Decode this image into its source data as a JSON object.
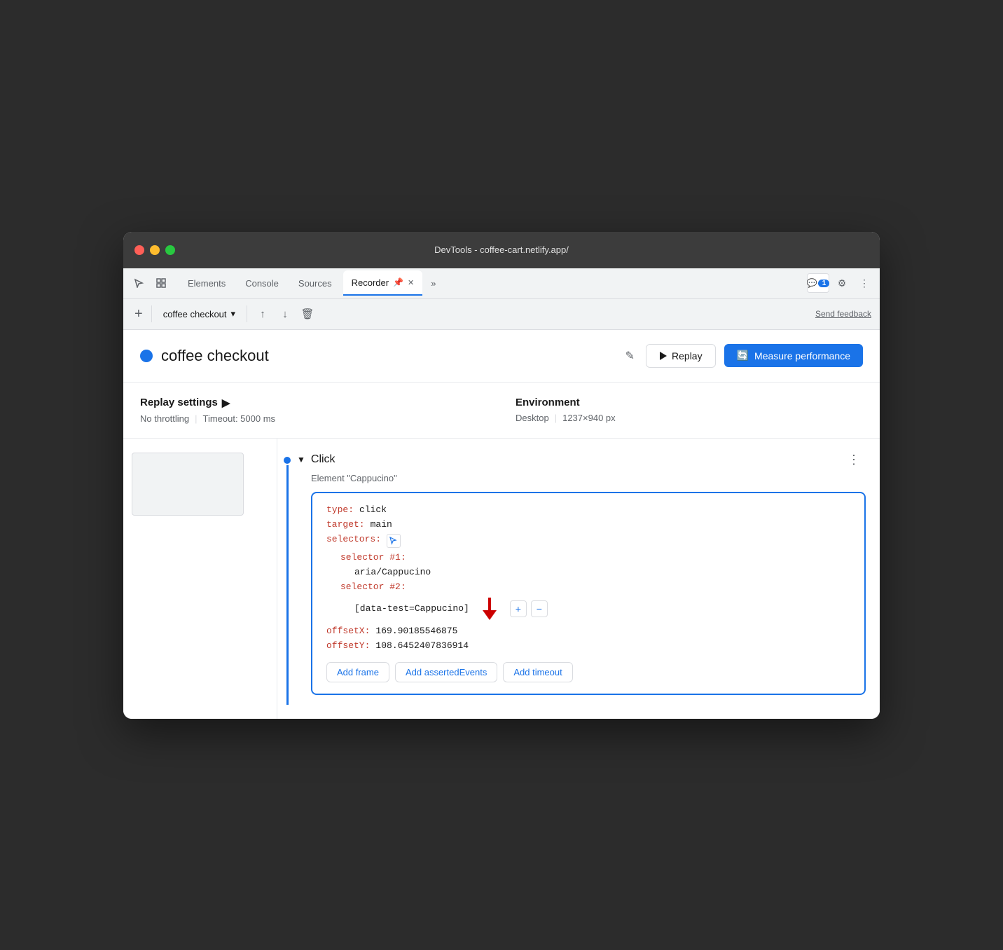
{
  "titlebar": {
    "title": "DevTools - coffee-cart.netlify.app/"
  },
  "tabs": [
    {
      "id": "elements",
      "label": "Elements",
      "active": false
    },
    {
      "id": "console",
      "label": "Console",
      "active": false
    },
    {
      "id": "sources",
      "label": "Sources",
      "active": false
    },
    {
      "id": "recorder",
      "label": "Recorder",
      "active": true
    },
    {
      "id": "more",
      "label": "»",
      "active": false
    }
  ],
  "notification": {
    "icon": "💬",
    "count": "1"
  },
  "toolbar": {
    "add_label": "+",
    "recording_name": "coffee checkout",
    "send_feedback": "Send feedback"
  },
  "recording": {
    "title": "coffee checkout",
    "replay_label": "Replay",
    "measure_label": "Measure performance"
  },
  "settings": {
    "title": "Replay settings",
    "throttling": "No throttling",
    "timeout": "Timeout: 5000 ms",
    "environment_title": "Environment",
    "device": "Desktop",
    "resolution": "1237×940 px"
  },
  "step": {
    "name": "Click",
    "subtitle": "Element \"Cappucino\"",
    "code": {
      "type_key": "type:",
      "type_val": "click",
      "target_key": "target:",
      "target_val": "main",
      "selectors_key": "selectors:",
      "selector1_key": "selector #1:",
      "selector1_val": "aria/Cappucino",
      "selector2_key": "selector #2:",
      "selector2_val": "[data-test=Cappucino]",
      "offsetx_key": "offsetX:",
      "offsetx_val": "169.90185546875",
      "offsety_key": "offsetY:",
      "offsety_val": "108.6452407836914"
    },
    "add_frame": "Add frame",
    "add_asserted_events": "Add assertedEvents",
    "add_timeout": "Add timeout"
  }
}
